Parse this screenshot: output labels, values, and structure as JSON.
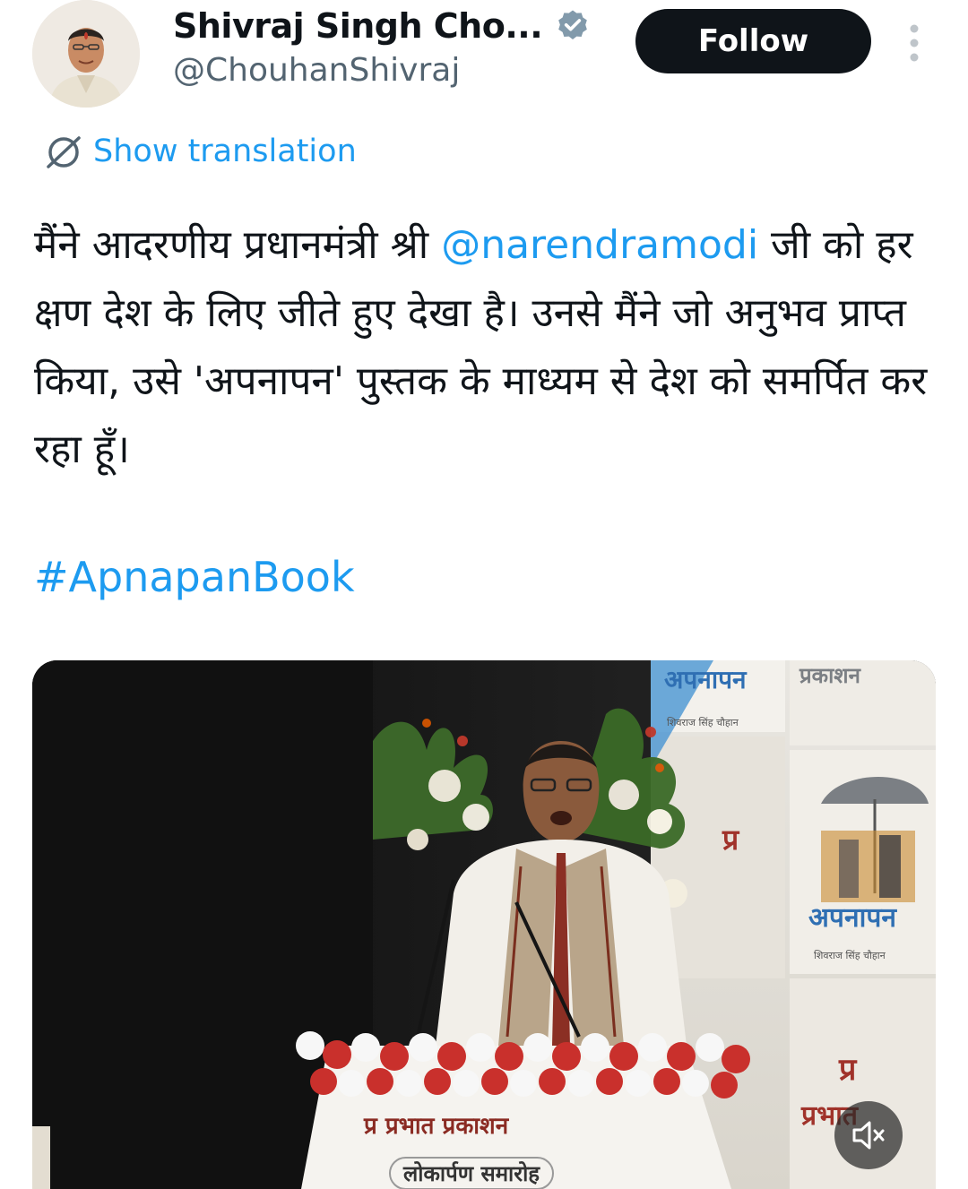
{
  "author": {
    "display_name": "Shivraj Singh Cho...",
    "handle": "@ChouhanShivraj",
    "verified": true
  },
  "actions": {
    "follow_label": "Follow",
    "more_icon": "more-vertical-icon"
  },
  "translation": {
    "label": "Show translation",
    "icon": "translate-icon"
  },
  "tweet": {
    "text_before_mention": "मैंने आदरणीय प्रधानमंत्री श्री ",
    "mention": "@narendramodi",
    "text_after_mention": " जी को हर क्षण देश के लिए जीते हुए देखा है। उनसे मैंने जो अनुभव प्राप्त किया, उसे 'अपनापन' पुस्तक के माध्यम से देश को समर्पित कर रहा हूँ।",
    "hashtag": "#ApnapanBook"
  },
  "media": {
    "type": "video",
    "podium_banner": "प्र प्रभात प्रकाशन",
    "podium_subtitle": "लोकार्पण समारोह",
    "backdrop_title": "अपनापन",
    "backdrop_publisher": "प्रकाशन",
    "backdrop_author": "शिवराज सिंह चौहान",
    "backdrop_logo": "प्र",
    "backdrop_logo_text": "प्रभात",
    "mute_icon": "volume-muted-icon"
  },
  "colors": {
    "link": "#1d9bf0",
    "text": "#0f1419",
    "secondary": "#536471",
    "follow_bg": "#0f1419"
  }
}
